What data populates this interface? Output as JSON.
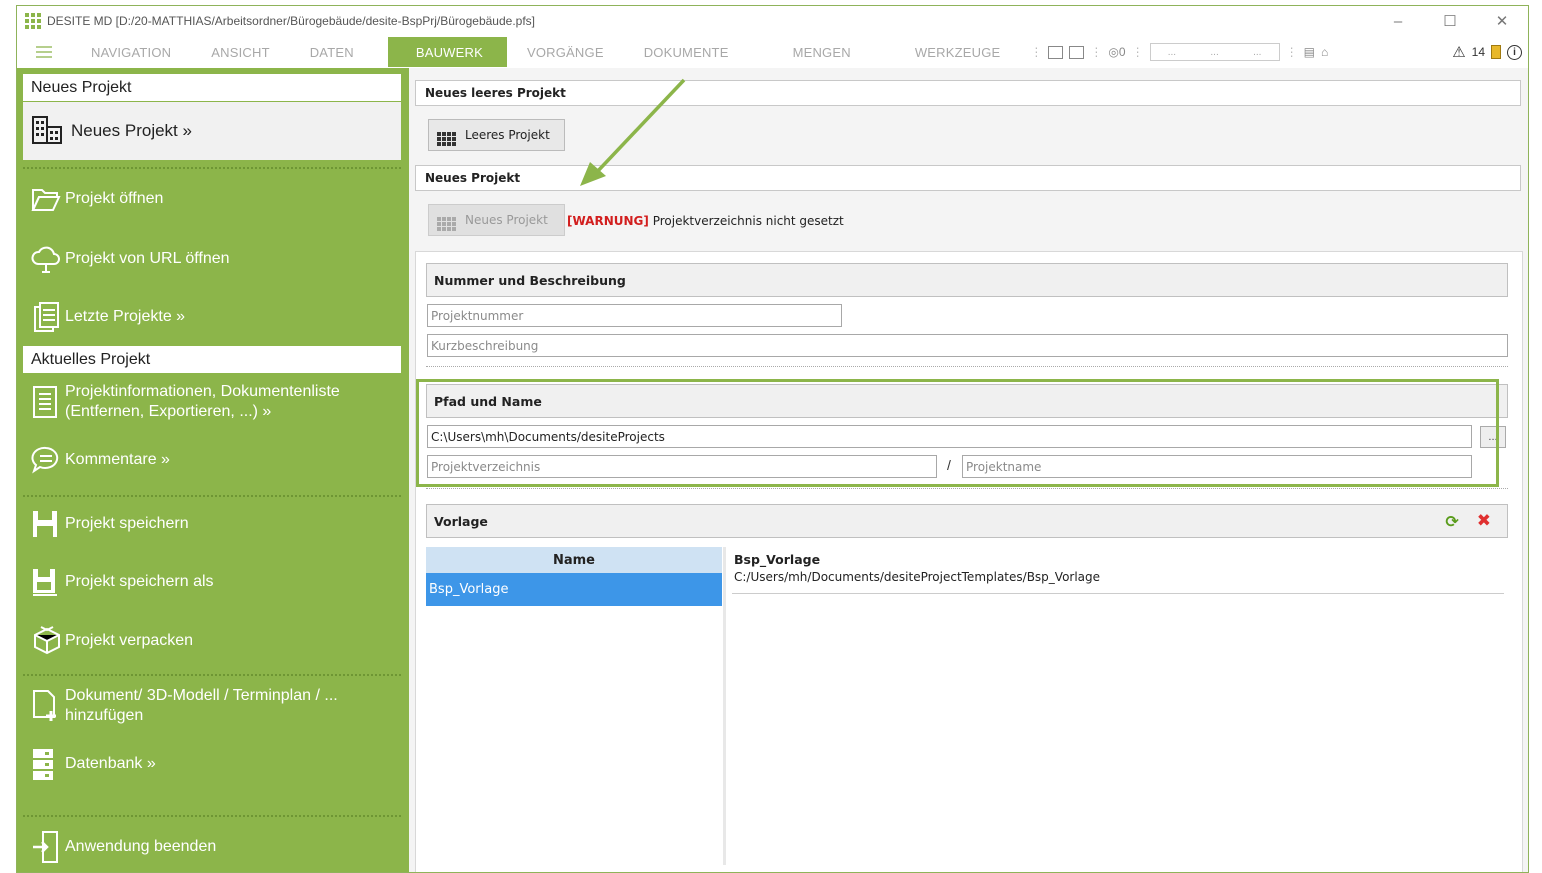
{
  "window": {
    "title": "DESITE MD [D:/20-MATTHIAS/Arbeitsordner/Bürogebäude/desite-BspPrj/Bürogebäude.pfs]"
  },
  "ribbon": {
    "tabs": [
      {
        "label": "NAVIGATION"
      },
      {
        "label": "ANSICHT"
      },
      {
        "label": "DATEN"
      },
      {
        "label": "BAUWERK"
      },
      {
        "label": "VORGÄNGE"
      },
      {
        "label": "DOKUMENTE"
      },
      {
        "label": "MENGEN"
      },
      {
        "label": "WERKZEUGE"
      }
    ],
    "active_tab": "BAUWERK",
    "counter_zero": "0",
    "quick_box": [
      "...",
      "...",
      "..."
    ],
    "warning_count": "14"
  },
  "sidebar": {
    "header_new": "Neues Projekt",
    "selected_item": "Neues Projekt »",
    "items_top": [
      "Projekt öffnen",
      "Projekt von URL öffnen",
      "Letzte Projekte »"
    ],
    "header_current": "Aktuelles Projekt",
    "info_line1": "Projektinformationen, Dokumentenliste",
    "info_line2": "(Entfernen, Exportieren, ...) »",
    "comments": "Kommentare »",
    "save": "Projekt speichern",
    "save_as": "Projekt speichern als",
    "pack": "Projekt verpacken",
    "add_line1": "Dokument/ 3D-Modell / Terminplan / ...",
    "add_line2": "hinzufügen",
    "database": "Datenbank »",
    "quit": "Anwendung beenden"
  },
  "main": {
    "section_empty": "Neues leeres Projekt",
    "btn_empty": "Leeres Projekt",
    "section_new": "Neues Projekt",
    "btn_new": "Neues Projekt",
    "warning_tag": "[WARNUNG]",
    "warning_text": "Projektverzeichnis nicht gesetzt",
    "group_number": "Nummer und Beschreibung",
    "projektnummer_placeholder": "Projektnummer",
    "kurzbeschreibung_placeholder": "Kurzbeschreibung",
    "group_path": "Pfad und Name",
    "path_value": "C:\\Users\\mh\\Documents/desiteProjects",
    "browse_label": "...",
    "verzeichnis_placeholder": "Projektverzeichnis",
    "slash": "/",
    "projektname_placeholder": "Projektname",
    "group_template": "Vorlage",
    "table_header": "Name",
    "table_row": "Bsp_Vorlage",
    "template_name": "Bsp_Vorlage",
    "template_path": "C:/Users/mh/Documents/desiteProjectTemplates/Bsp_Vorlage"
  },
  "colors": {
    "accent": "#8cb54a",
    "selection": "#3d96e8",
    "warning": "#d21e1e"
  }
}
